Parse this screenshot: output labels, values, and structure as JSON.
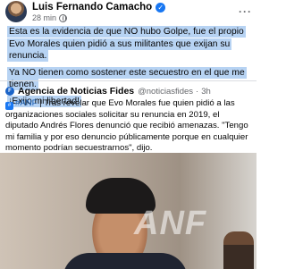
{
  "post": {
    "author": "Luis Fernando Camacho",
    "time": "28 min",
    "paragraphs": [
      "Esta es la evidencia de que NO hubo Golpe, fue el propio Evo Morales quien pidió a sus militantes que exijan su renuncia.",
      "Ya NO tienen como sostener este secuestro en el que me tienen.",
      "¡Exijo mi libertad!"
    ]
  },
  "shared": {
    "page_name": "Agencia de Noticias Fides",
    "handle": "@noticiasfides",
    "separator": "·",
    "time": "3h",
    "hashtag": "#ANF",
    "text": " | Tras revelar que Evo Morales fue quien pidió a las organizaciones sociales solicitar su renuncia en 2019, el diputado Andrés Flores denunció que recibió amenazas. \"Tengo mi familia y por eso denuncio públicamente porque en cualquier momento podrían secuestrarnos\", dijo."
  },
  "photo": {
    "watermark": "ANF"
  },
  "icons": {
    "verified": "verified-badge-icon",
    "globe": "globe-icon",
    "more": "more-options-icon",
    "logo": "fides-logo-icon",
    "tag": "tag-icon"
  },
  "colors": {
    "highlight": "#b7d3f3",
    "verified": "#1877f2",
    "muted_text": "#65676b"
  }
}
